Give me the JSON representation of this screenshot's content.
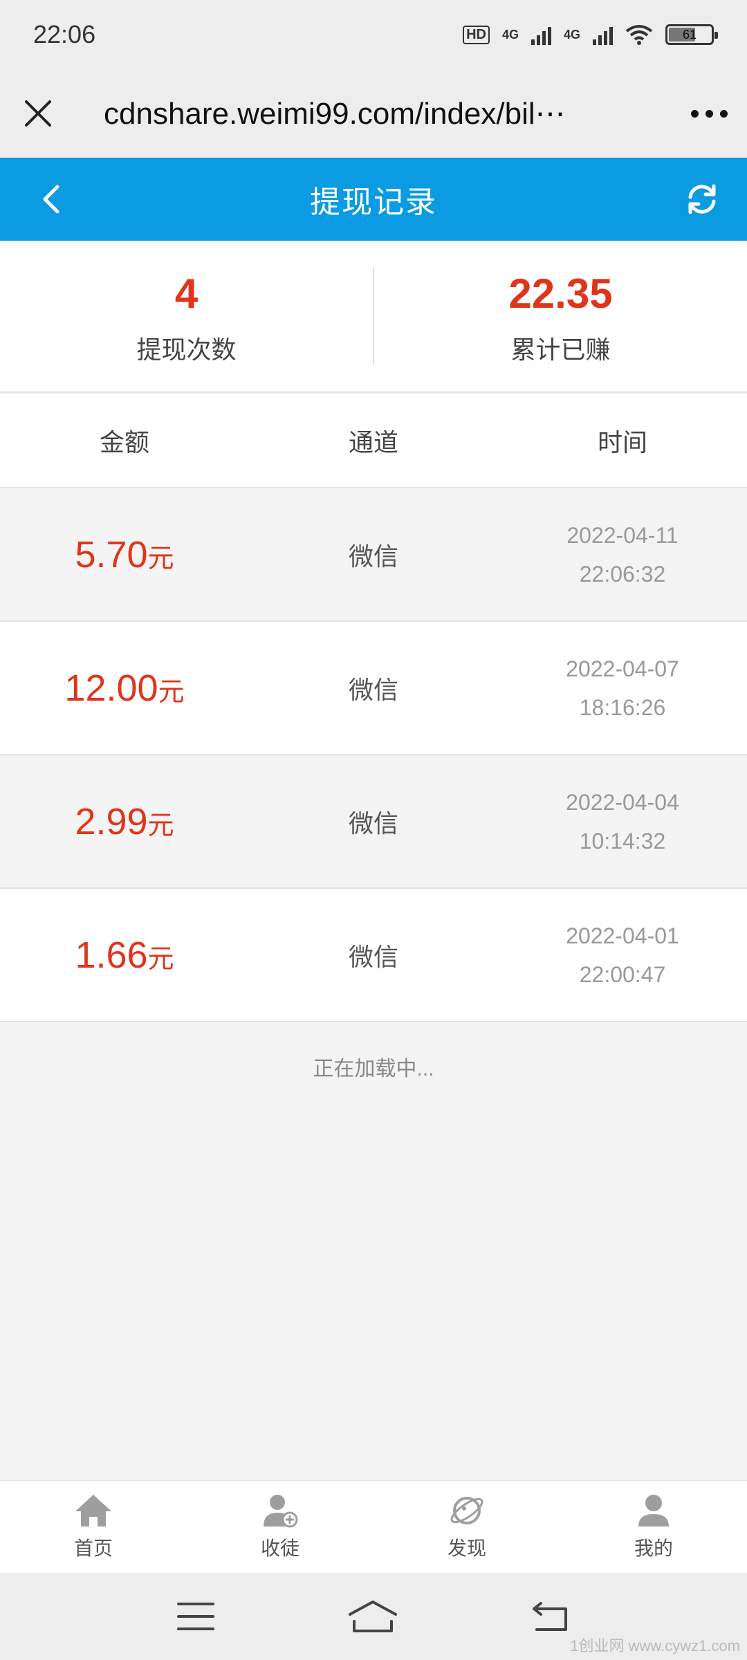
{
  "status_bar": {
    "time": "22:06",
    "hd_label": "HD",
    "net1": "4G",
    "net2": "4G",
    "battery": "61"
  },
  "browser": {
    "url": "cdnshare.weimi99.com/index/bil⋯"
  },
  "header": {
    "title": "提现记录"
  },
  "summary": {
    "count_value": "4",
    "count_label": "提现次数",
    "earned_value": "22.35",
    "earned_label": "累计已赚"
  },
  "table": {
    "headers": [
      "金额",
      "通道",
      "时间"
    ],
    "rows": [
      {
        "amount": "5.70",
        "unit": "元",
        "channel": "微信",
        "date": "2022-04-11",
        "time": "22:06:32"
      },
      {
        "amount": "12.00",
        "unit": "元",
        "channel": "微信",
        "date": "2022-04-07",
        "time": "18:16:26"
      },
      {
        "amount": "2.99",
        "unit": "元",
        "channel": "微信",
        "date": "2022-04-04",
        "time": "10:14:32"
      },
      {
        "amount": "1.66",
        "unit": "元",
        "channel": "微信",
        "date": "2022-04-01",
        "time": "22:00:47"
      }
    ]
  },
  "loading_text": "正在加载中...",
  "tabbar": {
    "items": [
      {
        "label": "首页",
        "icon": "home-icon"
      },
      {
        "label": "收徒",
        "icon": "add-user-icon"
      },
      {
        "label": "发现",
        "icon": "discover-icon"
      },
      {
        "label": "我的",
        "icon": "user-icon"
      }
    ]
  },
  "watermark": "1创业网 www.cywz1.com",
  "colors": {
    "header": "#0b9be3",
    "accent_red": "#e0341c"
  }
}
